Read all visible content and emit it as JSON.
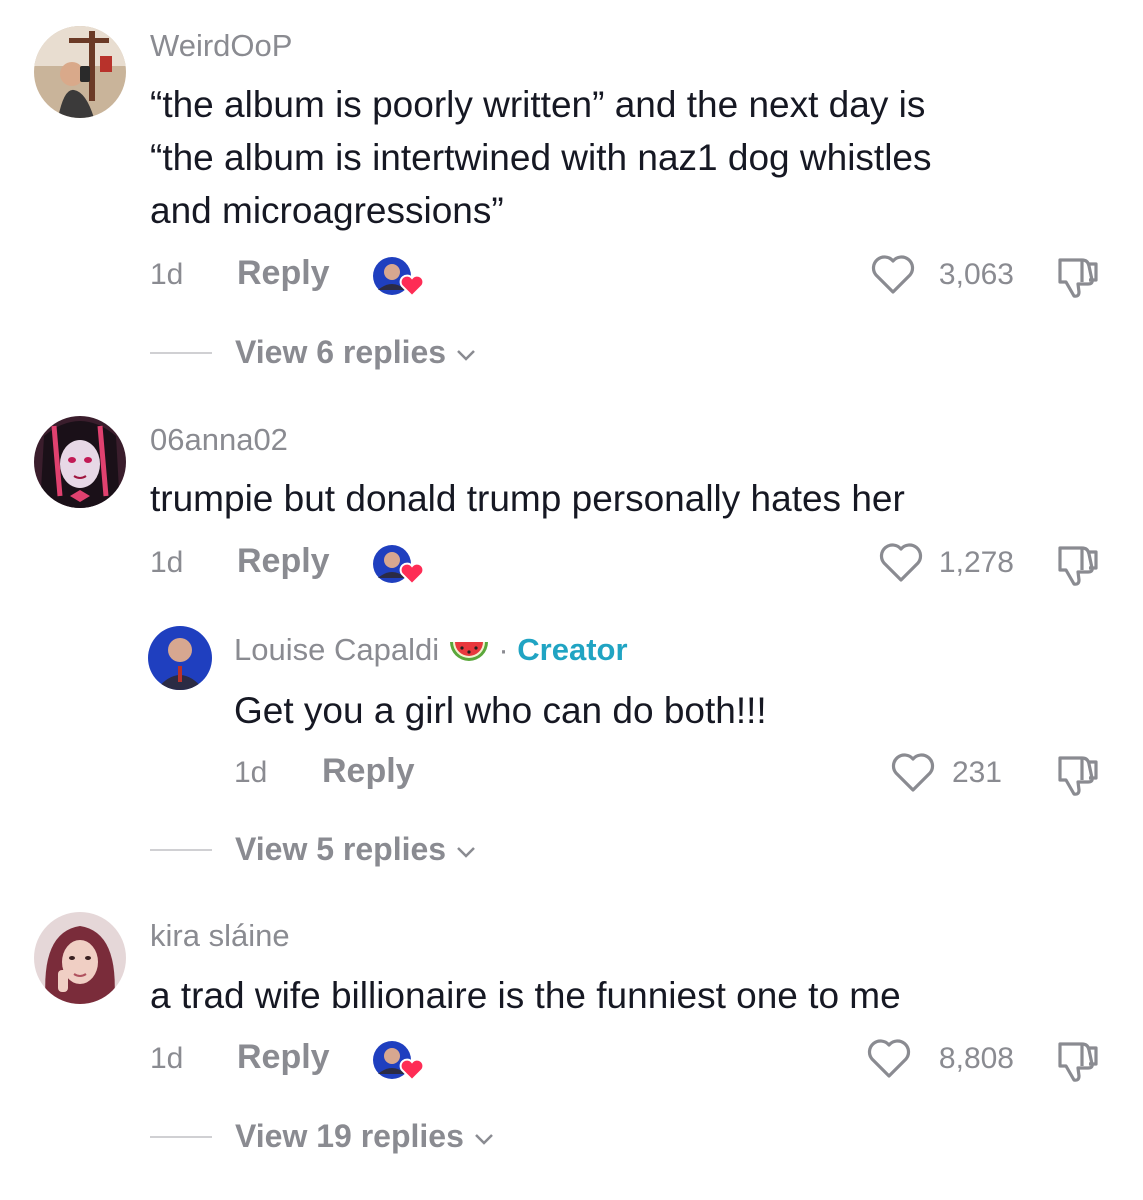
{
  "comments": [
    {
      "username": "WeirdOoP",
      "lines": [
        "“the album is poorly written” and the next day is",
        "“the album is intertwined with naz1 dog whistles",
        "and microagressions”"
      ],
      "time": "1d",
      "reply_label": "Reply",
      "likes": "3,063",
      "view_replies": "View 6 replies"
    },
    {
      "username": "06anna02",
      "lines": [
        "trumpie but donald trump personally hates her"
      ],
      "time": "1d",
      "reply_label": "Reply",
      "likes": "1,278",
      "sub_reply": {
        "username": "Louise Capaldi",
        "badge_dot": "·",
        "badge": "Creator",
        "text": "Get you a girl who can do both!!!",
        "time": "1d",
        "reply_label": "Reply",
        "likes": "231"
      },
      "view_replies": "View 5 replies"
    },
    {
      "username": "kira sláine",
      "lines": [
        "a trad wife billionaire is the funniest one to me"
      ],
      "time": "1d",
      "reply_label": "Reply",
      "likes": "8,808",
      "view_replies": "View 19 replies"
    }
  ],
  "colors": {
    "text": "#161823",
    "muted": "#8a8b91",
    "creator": "#20a4c3",
    "heart_badge": "#fe2c55"
  },
  "icons": [
    "heart-icon",
    "dislike-icon",
    "chevron-down-icon",
    "watermelon-icon",
    "creator-liked-badge"
  ]
}
